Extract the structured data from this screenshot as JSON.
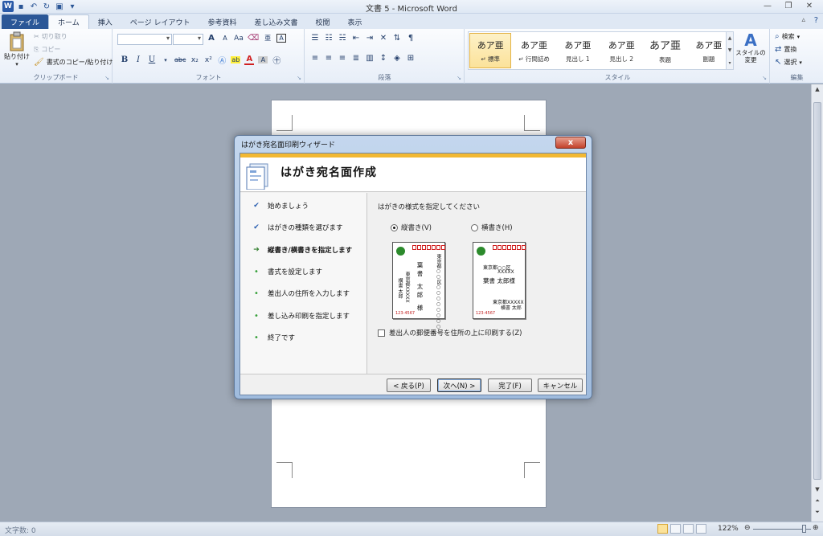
{
  "window": {
    "title": "文書 5 - Microsoft Word",
    "app_icon": "W"
  },
  "ribbon_tabs": [
    "ファイル",
    "ホーム",
    "挿入",
    "ページ レイアウト",
    "参考資料",
    "差し込み文書",
    "校閲",
    "表示"
  ],
  "clipboard": {
    "paste": "貼り付け",
    "cut": "切り取り",
    "copy": "コピー",
    "format_painter": "書式のコピー/貼り付け",
    "label": "クリップボード"
  },
  "font": {
    "label": "フォント",
    "bold": "B",
    "italic": "I",
    "underline": "U",
    "strike": "abc",
    "subscript": "x₂",
    "superscript": "x²",
    "grow": "A",
    "shrink": "A",
    "case": "Aa",
    "clear": "A",
    "color": "A",
    "char_border": "A"
  },
  "paragraph": {
    "label": "段落"
  },
  "styles": {
    "label": "スタイル",
    "items": [
      {
        "preview": "あア亜",
        "name": "↵ 標準"
      },
      {
        "preview": "あア亜",
        "name": "↵ 行間詰め"
      },
      {
        "preview": "あア亜",
        "name": "見出し 1"
      },
      {
        "preview": "あア亜",
        "name": "見出し 2"
      },
      {
        "preview": "あア亜",
        "name": "表題"
      },
      {
        "preview": "あア亜",
        "name": "副題"
      }
    ],
    "change_styles": "スタイルの変更"
  },
  "editing": {
    "label": "編集",
    "find": "検索",
    "replace": "置換",
    "select": "選択"
  },
  "statusbar": {
    "word_count": "文字数: 0",
    "zoom": "122%"
  },
  "dialog": {
    "title": "はがき宛名面印刷ウィザード",
    "close": "x",
    "header": "はがき宛名面作成",
    "steps": [
      {
        "label": "始めましょう",
        "state": "done"
      },
      {
        "label": "はがきの種類を選びます",
        "state": "done"
      },
      {
        "label": "縦書き/横書きを指定します",
        "state": "current"
      },
      {
        "label": "書式を設定します",
        "state": "todo"
      },
      {
        "label": "差出人の住所を入力します",
        "state": "todo"
      },
      {
        "label": "差し込み印刷を指定します",
        "state": "todo"
      },
      {
        "label": "終了です",
        "state": "todo"
      }
    ],
    "prompt": "はがきの様式を指定してください",
    "options": {
      "vertical": "縦書き(V)",
      "horizontal": "横書き(H)",
      "selected": "vertical"
    },
    "vertical_card": {
      "address": "東京都○○区○○○○○○○○",
      "name": "葉書 太郎 様",
      "sender": "東京都XXXXX",
      "sender_name": "横書 太郎",
      "code": "123-4567"
    },
    "horizontal_card": {
      "address": "東京都○○区",
      "address2": "XXXXX",
      "name": "葉書 太郎様",
      "sender": "東京都XXXXX",
      "sender_name": "横書 太郎",
      "code": "123-4567"
    },
    "checkbox": "差出人の郵便番号を住所の上に印刷する(Z)",
    "buttons": {
      "back": "< 戻る(P)",
      "next": "次へ(N) >",
      "finish": "完了(F)",
      "cancel": "キャンセル"
    }
  },
  "colors": {
    "file_tab": "#2b5797",
    "header_accent": "#f2b833",
    "current_step": "#2f7d2b",
    "postal_red": "#d02020"
  }
}
